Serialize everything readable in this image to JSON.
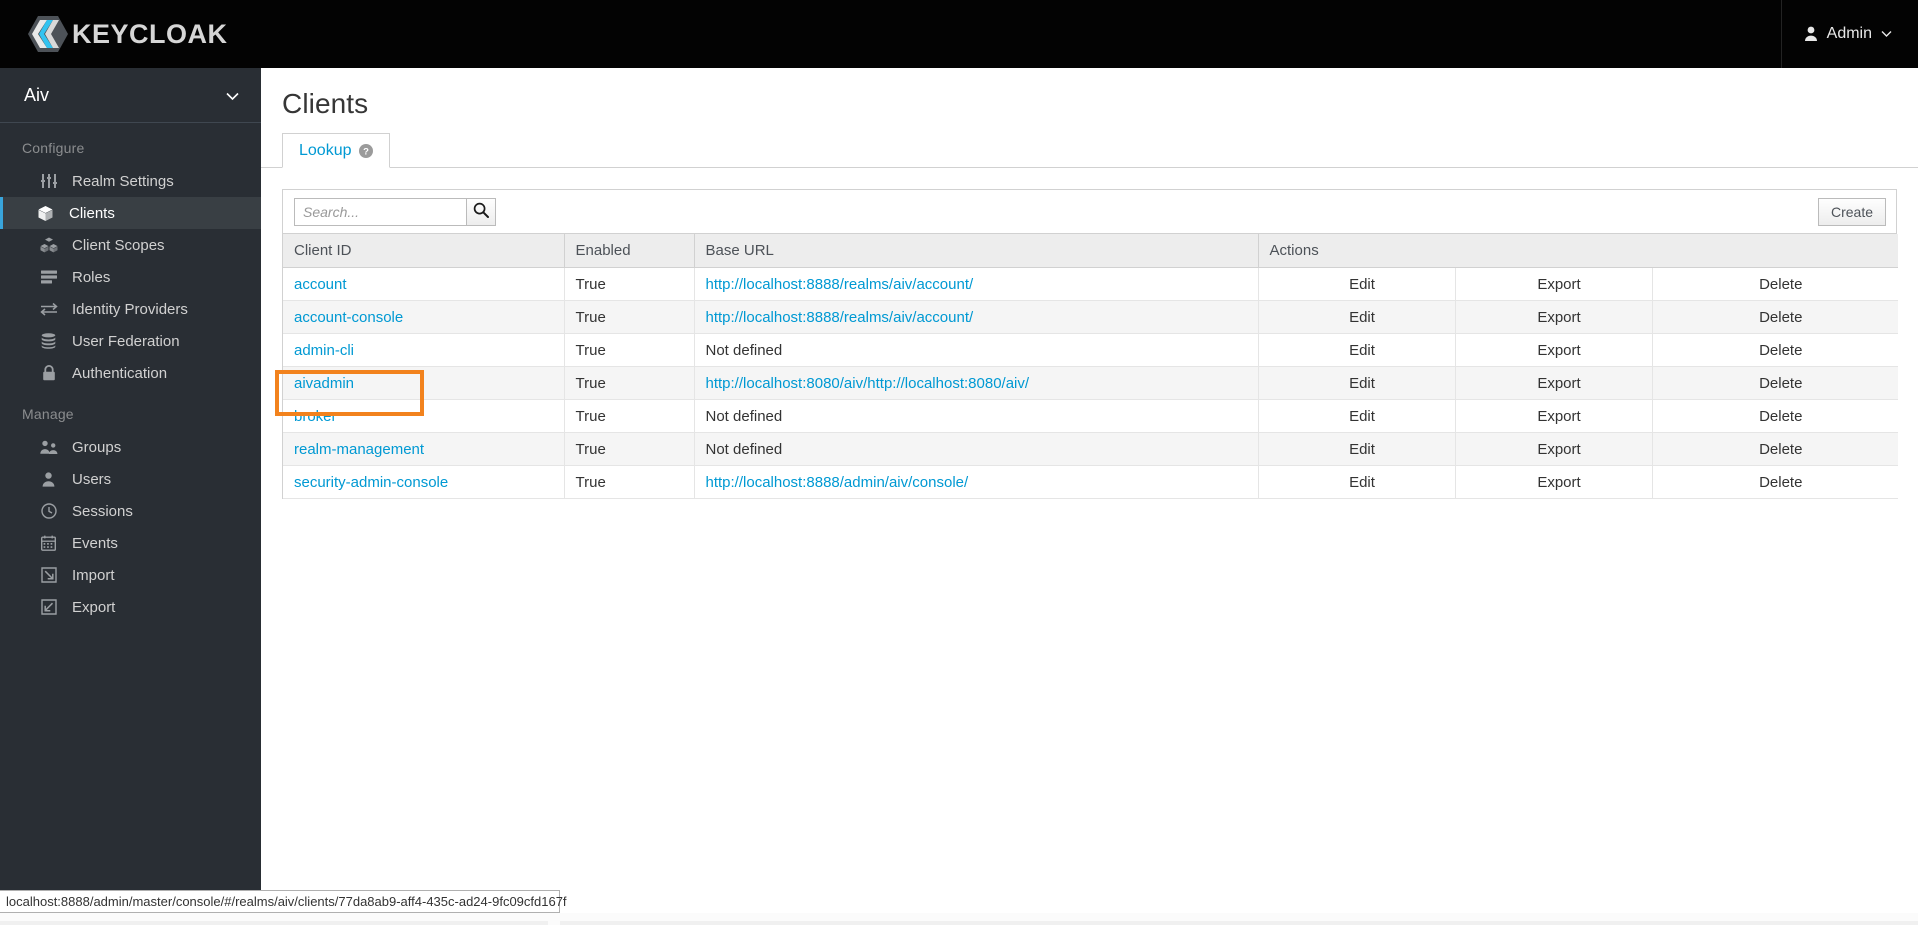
{
  "masthead": {
    "brand_text": "KEYCLOAK",
    "logo_icon": "keycloak-logo-icon",
    "user": {
      "icon": "user-icon",
      "label": "Admin",
      "caret_icon": "chevron-down-icon"
    }
  },
  "sidebar": {
    "realm": {
      "name": "Aiv",
      "caret_icon": "chevron-down-icon"
    },
    "sections": [
      {
        "title": "Configure",
        "items": [
          {
            "label": "Realm Settings",
            "icon": "sliders-icon",
            "active": false
          },
          {
            "label": "Clients",
            "icon": "cube-icon",
            "active": true
          },
          {
            "label": "Client Scopes",
            "icon": "cubes-icon",
            "active": false
          },
          {
            "label": "Roles",
            "icon": "list-icon",
            "active": false
          },
          {
            "label": "Identity Providers",
            "icon": "exchange-arrows-icon",
            "active": false
          },
          {
            "label": "User Federation",
            "icon": "database-icon",
            "active": false
          },
          {
            "label": "Authentication",
            "icon": "lock-icon",
            "active": false
          }
        ]
      },
      {
        "title": "Manage",
        "items": [
          {
            "label": "Groups",
            "icon": "users-group-icon",
            "active": false
          },
          {
            "label": "Users",
            "icon": "user-icon",
            "active": false
          },
          {
            "label": "Sessions",
            "icon": "clock-icon",
            "active": false
          },
          {
            "label": "Events",
            "icon": "calendar-icon",
            "active": false
          },
          {
            "label": "Import",
            "icon": "import-arrow-icon",
            "active": false
          },
          {
            "label": "Export",
            "icon": "export-arrow-icon",
            "active": false
          }
        ]
      }
    ]
  },
  "main": {
    "page_title": "Clients",
    "tabs": [
      {
        "label": "Lookup",
        "help_icon": "question-circle-icon",
        "active": true
      }
    ],
    "toolbar": {
      "search_placeholder": "Search...",
      "search_value": "",
      "search_icon": "search-icon",
      "create_label": "Create"
    },
    "table": {
      "columns": [
        "Client ID",
        "Enabled",
        "Base URL",
        "Actions"
      ],
      "action_labels": [
        "Edit",
        "Export",
        "Delete"
      ],
      "not_defined_text": "Not defined",
      "rows": [
        {
          "client_id": "account",
          "enabled": "True",
          "base_url": "http://localhost:8888/realms/aiv/account/",
          "base_url_defined": true
        },
        {
          "client_id": "account-console",
          "enabled": "True",
          "base_url": "http://localhost:8888/realms/aiv/account/",
          "base_url_defined": true
        },
        {
          "client_id": "admin-cli",
          "enabled": "True",
          "base_url": "Not defined",
          "base_url_defined": false
        },
        {
          "client_id": "aivadmin",
          "enabled": "True",
          "base_url": "http://localhost:8080/aiv/http://localhost:8080/aiv/",
          "base_url_defined": true
        },
        {
          "client_id": "broker",
          "enabled": "True",
          "base_url": "Not defined",
          "base_url_defined": false
        },
        {
          "client_id": "realm-management",
          "enabled": "True",
          "base_url": "Not defined",
          "base_url_defined": false
        },
        {
          "client_id": "security-admin-console",
          "enabled": "True",
          "base_url": "http://localhost:8888/admin/aiv/console/",
          "base_url_defined": true
        }
      ]
    }
  },
  "highlight": {
    "target": "aivadmin",
    "color": "#f2821d"
  },
  "statusbar": {
    "url": "localhost:8888/admin/master/console/#/realms/aiv/clients/77da8ab9-aff4-435c-ad24-9fc09cfd167f"
  },
  "colors": {
    "masthead_bg": "#030303",
    "sidebar_bg": "#292e34",
    "sidebar_active_bg": "#393f44",
    "accent_blue": "#39a5dc",
    "link_blue": "#0099d3",
    "highlight_orange": "#f2821d"
  }
}
